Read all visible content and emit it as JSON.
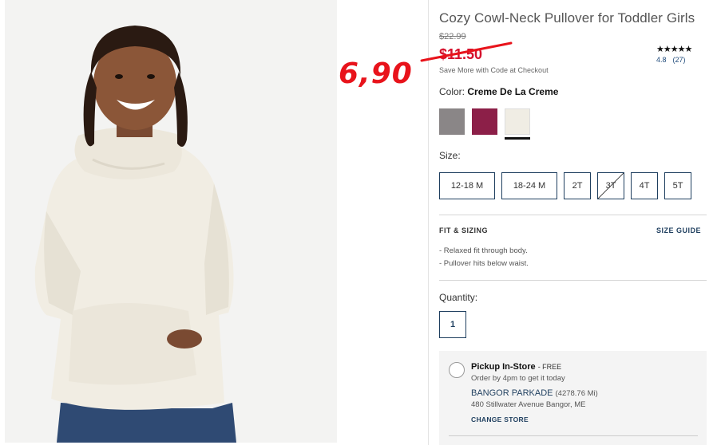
{
  "product": {
    "title": "Cozy Cowl-Neck Pullover for Toddler Girls",
    "original_price": "$22.99",
    "sale_price": "$11.50",
    "save_note": "Save More with Code at Checkout",
    "annotation": "6,90",
    "rating_stars": "★★★★★",
    "rating_value": "4.8",
    "rating_count": "(27)"
  },
  "color": {
    "label": "Color:",
    "selected": "Creme De La Creme",
    "swatches": [
      "#8a8687",
      "#8c1f48",
      "#f0ede4"
    ]
  },
  "size": {
    "label": "Size:",
    "options": [
      "12-18 M",
      "18-24 M",
      "2T",
      "3T",
      "4T",
      "5T"
    ],
    "unavailable": "3T"
  },
  "fit": {
    "heading": "FIT & SIZING",
    "guide_link": "SIZE GUIDE",
    "items": [
      "-  Relaxed fit through body.",
      "-  Pullover hits below waist."
    ]
  },
  "quantity": {
    "label": "Quantity:",
    "value": "1"
  },
  "pickup": {
    "title": "Pickup In-Store",
    "free": "- FREE",
    "order_note": "Order by 4pm to get it today",
    "store_name": "BANGOR PARKADE",
    "distance": "(4278.76 Mi)",
    "address": "480 Stillwater Avenue Bangor, ME",
    "change_link": "CHANGE STORE"
  },
  "colors": {
    "sale": "#d5102c",
    "navy": "#1f3f5f",
    "annotation": "#e8131b"
  }
}
